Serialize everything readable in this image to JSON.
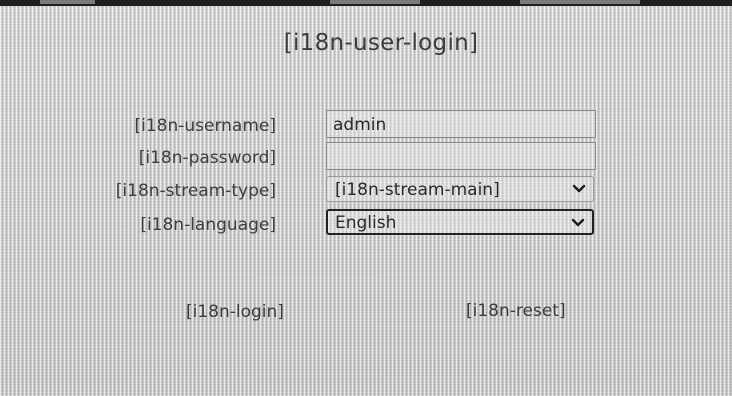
{
  "login": {
    "title": "[i18n-user-login]",
    "fields": {
      "username": {
        "label": "[i18n-username]",
        "value": "admin"
      },
      "password": {
        "label": "[i18n-password]",
        "value": ""
      },
      "stream_type": {
        "label": "[i18n-stream-type]",
        "selected": "[i18n-stream-main]"
      },
      "language": {
        "label": "[i18n-language]",
        "selected": "English"
      }
    },
    "buttons": {
      "login": "[i18n-login]",
      "reset": "[i18n-reset]"
    }
  },
  "icons": {
    "dropdown": "chevron-down-icon"
  },
  "colors": {
    "background": "#d4d4d4",
    "text": "#3a3a3a",
    "focus_border": "#222222"
  }
}
